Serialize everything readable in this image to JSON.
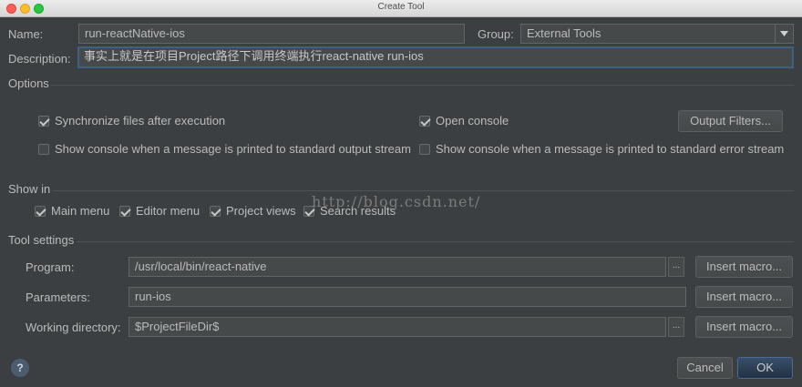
{
  "window": {
    "title": "Create Tool"
  },
  "form": {
    "name_label": "Name:",
    "name_value": "run-reactNative-ios",
    "group_label": "Group:",
    "group_value": "External Tools",
    "description_label": "Description:",
    "description_value": "事实上就是在项目Project路径下调用终端执行react-native run-ios"
  },
  "options": {
    "title": "Options",
    "sync_files": {
      "label": "Synchronize files after execution",
      "checked": true
    },
    "open_console": {
      "label": "Open console",
      "checked": true
    },
    "output_filters_button": "Output Filters...",
    "console_stdout": {
      "label": "Show console when a message is printed to standard output stream",
      "checked": false
    },
    "console_stderr": {
      "label": "Show console when a message is printed to standard error stream",
      "checked": false
    }
  },
  "show_in": {
    "title": "Show in",
    "main_menu": {
      "label": "Main menu",
      "checked": true
    },
    "editor_menu": {
      "label": "Editor menu",
      "checked": true
    },
    "project_views": {
      "label": "Project views",
      "checked": true
    },
    "search_results": {
      "label": "Search results",
      "checked": true
    }
  },
  "tool_settings": {
    "title": "Tool settings",
    "program_label": "Program:",
    "program_value": "/usr/local/bin/react-native",
    "parameters_label": "Parameters:",
    "parameters_value": "run-ios",
    "working_dir_label": "Working directory:",
    "working_dir_value": "$ProjectFileDir$",
    "insert_macro": "Insert macro...",
    "browse": "..."
  },
  "footer": {
    "help": "?",
    "cancel": "Cancel",
    "ok": "OK"
  },
  "watermark": "http://blog.csdn.net/"
}
